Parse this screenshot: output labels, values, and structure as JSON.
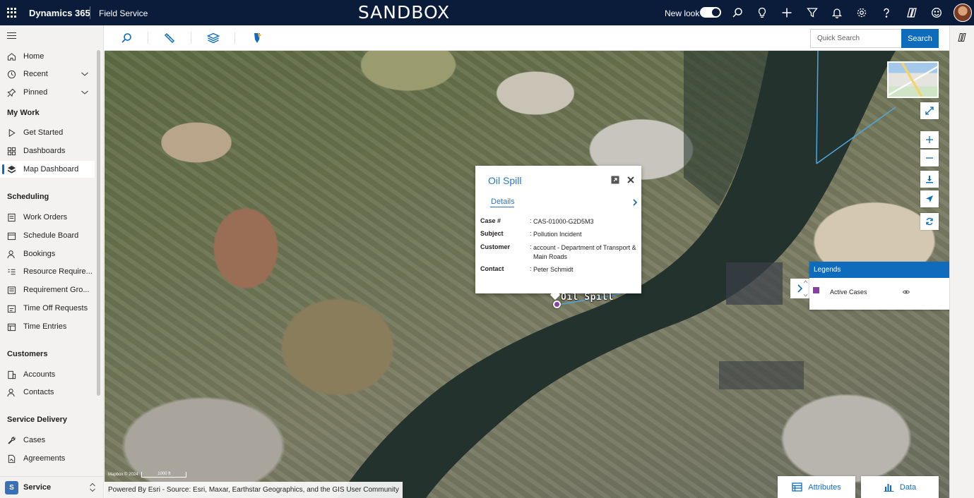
{
  "topbar": {
    "brand": "Dynamics 365",
    "app_name": "Field Service",
    "environment": "SANDBOX",
    "new_look_label": "New look",
    "icons": [
      "waffle-icon",
      "search-icon",
      "lightbulb-icon",
      "plus-icon",
      "filter-icon",
      "bell-icon",
      "gear-icon",
      "help-icon",
      "copilot-icon",
      "smiley-icon",
      "avatar"
    ]
  },
  "sidenav": {
    "items_top": [
      {
        "label": "Home",
        "icon": "home-icon"
      },
      {
        "label": "Recent",
        "icon": "clock-icon"
      },
      {
        "label": "Pinned",
        "icon": "pin-icon"
      }
    ],
    "groups": [
      {
        "title": "My Work",
        "items": [
          {
            "label": "Get Started",
            "icon": "play-icon"
          },
          {
            "label": "Dashboards",
            "icon": "dashboard-icon"
          },
          {
            "label": "Map Dashboard",
            "icon": "map-icon",
            "active": true
          }
        ]
      },
      {
        "title": "Scheduling",
        "items": [
          {
            "label": "Work Orders",
            "icon": "work-order-icon"
          },
          {
            "label": "Schedule Board",
            "icon": "calendar-icon"
          },
          {
            "label": "Bookings",
            "icon": "person-icon"
          },
          {
            "label": "Resource Require...",
            "icon": "list-icon"
          },
          {
            "label": "Requirement Gro...",
            "icon": "group-icon"
          },
          {
            "label": "Time Off Requests",
            "icon": "time-off-icon"
          },
          {
            "label": "Time Entries",
            "icon": "calendar-icon"
          }
        ]
      },
      {
        "title": "Customers",
        "items": [
          {
            "label": "Accounts",
            "icon": "building-icon"
          },
          {
            "label": "Contacts",
            "icon": "person-icon"
          }
        ]
      },
      {
        "title": "Service Delivery",
        "items": [
          {
            "label": "Cases",
            "icon": "wrench-icon"
          },
          {
            "label": "Agreements",
            "icon": "document-icon"
          }
        ]
      }
    ],
    "area": {
      "badge": "S",
      "label": "Service"
    }
  },
  "map_toolbar": {
    "tools": [
      "search-tool-icon",
      "measure-tool-icon",
      "layers-tool-icon",
      "marker-tool-icon"
    ],
    "search_placeholder": "Quick Search",
    "search_button": "Search"
  },
  "popup": {
    "title": "Oil Spill",
    "tab": "Details",
    "fields": [
      {
        "key": "Case #",
        "value": "CAS-01000-G2D5M3"
      },
      {
        "key": "Subject",
        "value": "Pollution Incident"
      },
      {
        "key": "Customer",
        "value": "account - Department of Transport & Main Roads"
      },
      {
        "key": "Contact",
        "value": "Peter Schmidt"
      }
    ]
  },
  "marker": {
    "label": "Oil Spill",
    "color": "#8a3fa5"
  },
  "legend": {
    "title": "Legends",
    "items": [
      {
        "label": "Active Cases",
        "color": "#8a3fa5"
      }
    ]
  },
  "attribution": "Powered By Esri - Source: Esri, Maxar, Earthstar Geographics, and the GIS User Community",
  "scale": {
    "copyright": "Mapbox © 2024",
    "distance": "1000 ft"
  },
  "bottom_buttons": {
    "attributes": "Attributes",
    "data": "Data"
  },
  "colors": {
    "topbar": "#0b1b3a",
    "accent": "#0f6cbd",
    "link": "#2b78c2"
  }
}
